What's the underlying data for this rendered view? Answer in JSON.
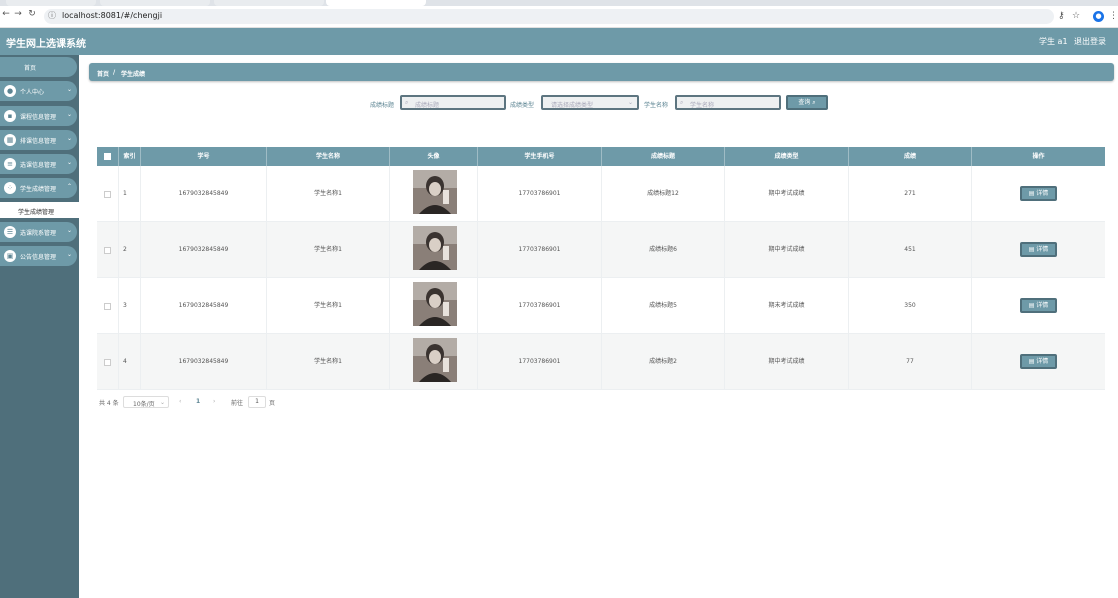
{
  "browser": {
    "url": "localhost:8081/#/chengji"
  },
  "header": {
    "app_title": "学生网上选课系统",
    "user_name": "学生 a1",
    "logout_label": "退出登录"
  },
  "sidebar": {
    "home": "首页",
    "items": [
      {
        "label": "个人中心",
        "icon": "user-icon"
      },
      {
        "label": "课程信息管理",
        "icon": "book-icon"
      },
      {
        "label": "排课信息管理",
        "icon": "calendar-icon"
      },
      {
        "label": "选课信息管理",
        "icon": "list-icon"
      },
      {
        "label": "学生成绩管理",
        "icon": "grid-icon"
      },
      {
        "label": "选课院系管理",
        "icon": "building-icon"
      },
      {
        "label": "公告信息管理",
        "icon": "bell-icon"
      }
    ],
    "sub_item": "学生成绩管理"
  },
  "breadcrumb": {
    "home": "首页",
    "separator": "/",
    "current": "学生成绩"
  },
  "filters": {
    "title_label": "成绩标题",
    "title_placeholder": "成绩标题",
    "type_label": "成绩类型",
    "type_placeholder": "请选择成绩类型",
    "name_label": "学生名称",
    "name_placeholder": "学生名称",
    "search_label": "查询"
  },
  "table": {
    "columns": [
      "索引",
      "学号",
      "学生名称",
      "头像",
      "学生手机号",
      "成绩标题",
      "成绩类型",
      "成绩",
      "操作"
    ],
    "rows": [
      {
        "index": "1",
        "student_id": "1679032845849",
        "name": "学生名称1",
        "phone": "17703786901",
        "title": "成绩标题12",
        "type": "期中考试成绩",
        "score": "271"
      },
      {
        "index": "2",
        "student_id": "1679032845849",
        "name": "学生名称1",
        "phone": "17703786901",
        "title": "成绩标题6",
        "type": "期中考试成绩",
        "score": "451"
      },
      {
        "index": "3",
        "student_id": "1679032845849",
        "name": "学生名称1",
        "phone": "17703786901",
        "title": "成绩标题5",
        "type": "期末考试成绩",
        "score": "350"
      },
      {
        "index": "4",
        "student_id": "1679032845849",
        "name": "学生名称1",
        "phone": "17703786901",
        "title": "成绩标题2",
        "type": "期中考试成绩",
        "score": "77"
      }
    ],
    "detail_label": "详情"
  },
  "pagination": {
    "total": "共 4 条",
    "page_size": "10条/页",
    "current_page": "1",
    "goto_label": "前往",
    "goto_value": "1",
    "page_unit": "页"
  },
  "colors": {
    "header": "#6e9aa8",
    "sidebar": "#4f6f7b"
  }
}
